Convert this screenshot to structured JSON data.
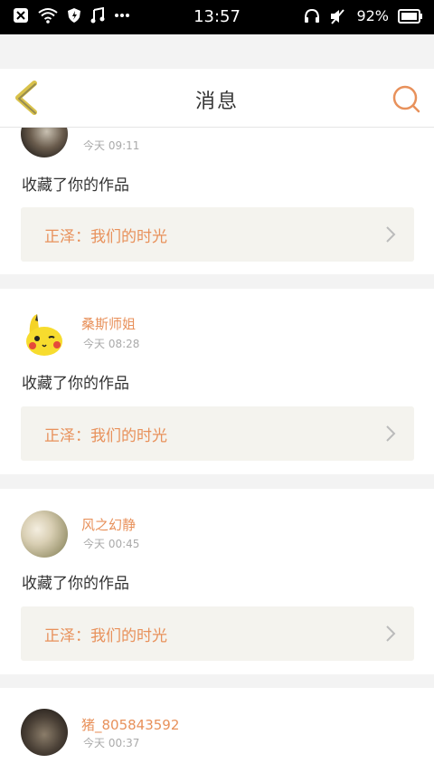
{
  "statusbar": {
    "time": "13:57",
    "battery": "92%"
  },
  "header": {
    "title": "消息"
  },
  "messages": [
    {
      "username": "",
      "time": "今天 09:11",
      "action": "收藏了你的作品",
      "work": "正泽：我们的时光"
    },
    {
      "username": "桑斯师姐",
      "time": "今天 08:28",
      "action": "收藏了你的作品",
      "work": "正泽：我们的时光"
    },
    {
      "username": "风之幻静",
      "time": "今天 00:45",
      "action": "收藏了你的作品",
      "work": "正泽：我们的时光"
    },
    {
      "username": "猪_805843592",
      "time": "今天 00:37",
      "action": "",
      "work": ""
    }
  ],
  "colors": {
    "accent": "#e8915b",
    "back_icon": "#d9c24a"
  },
  "icons": [
    "close-box-icon",
    "wifi-icon",
    "shield-icon",
    "music-icon",
    "more-icon",
    "headphones-icon",
    "mute-icon",
    "battery-icon",
    "back-chevron-icon",
    "search-icon",
    "chevron-right-icon"
  ]
}
